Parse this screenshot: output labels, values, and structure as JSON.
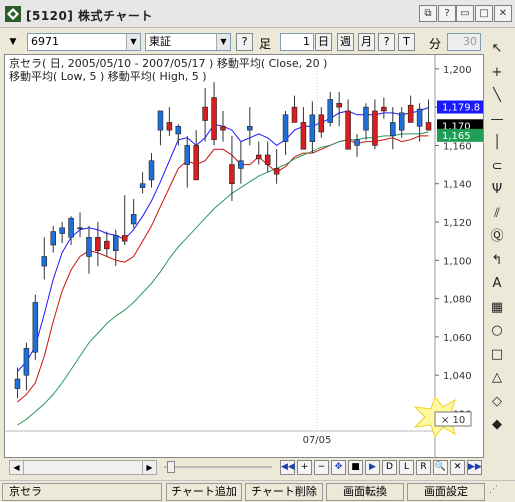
{
  "window": {
    "title": "[5120] 株式チャート",
    "buttons": [
      "restore-down",
      "help",
      "minimize",
      "maximize",
      "close"
    ]
  },
  "toolbar": {
    "symbol": "6971",
    "market": "東証",
    "help_label": "?",
    "foot_label": "足",
    "foot_count": "1",
    "day_label": "日",
    "week_label": "週",
    "month_label": "月",
    "split_label": "分",
    "q_label": "?",
    "t_label": "T",
    "min_label": "分",
    "min_count": "30"
  },
  "chart_data": {
    "type": "candlestick",
    "header_line1": "京セラ( 日, 2005/05/10 - 2007/05/17 )   移動平均( Close, 20 )",
    "header_line2": "移動平均( Low, 5 )   移動平均( High, 5 )",
    "y_ticks": [
      "1,200",
      "1,180",
      "1,160",
      "1,140",
      "1,120",
      "1,100",
      "1,080",
      "1,060",
      "1,040",
      "1,020"
    ],
    "ylim": [
      1014,
      1202
    ],
    "x_tick_label": "07/05",
    "badges": [
      {
        "label": "1,179.8",
        "value": 1179.8,
        "color": "#1a1aff"
      },
      {
        "label": "1,170",
        "value": 1170,
        "color": "#000000"
      },
      {
        "label": "1,165",
        "value": 1165,
        "color": "#1f9f55"
      }
    ],
    "candles": [
      {
        "o": 1033,
        "h": 1044,
        "l": 1028,
        "c": 1038
      },
      {
        "o": 1040,
        "h": 1057,
        "l": 1032,
        "c": 1054
      },
      {
        "o": 1052,
        "h": 1082,
        "l": 1048,
        "c": 1078
      },
      {
        "o": 1097,
        "h": 1112,
        "l": 1090,
        "c": 1102
      },
      {
        "o": 1108,
        "h": 1118,
        "l": 1104,
        "c": 1115
      },
      {
        "o": 1114,
        "h": 1120,
        "l": 1109,
        "c": 1117
      },
      {
        "o": 1112,
        "h": 1123,
        "l": 1108,
        "c": 1122
      },
      {
        "o": 1117,
        "h": 1125,
        "l": 1112,
        "c": 1117
      },
      {
        "o": 1102,
        "h": 1118,
        "l": 1093,
        "c": 1112
      },
      {
        "o": 1112,
        "h": 1120,
        "l": 1097,
        "c": 1105
      },
      {
        "o": 1110,
        "h": 1115,
        "l": 1102,
        "c": 1106
      },
      {
        "o": 1105,
        "h": 1116,
        "l": 1097,
        "c": 1113
      },
      {
        "o": 1113,
        "h": 1134,
        "l": 1108,
        "c": 1110
      },
      {
        "o": 1119,
        "h": 1132,
        "l": 1117,
        "c": 1124
      },
      {
        "o": 1138,
        "h": 1146,
        "l": 1135,
        "c": 1140
      },
      {
        "o": 1142,
        "h": 1156,
        "l": 1138,
        "c": 1152
      },
      {
        "o": 1168,
        "h": 1176,
        "l": 1160,
        "c": 1178
      },
      {
        "o": 1172,
        "h": 1180,
        "l": 1165,
        "c": 1168
      },
      {
        "o": 1166,
        "h": 1171,
        "l": 1160,
        "c": 1170
      },
      {
        "o": 1150,
        "h": 1165,
        "l": 1138,
        "c": 1160
      },
      {
        "o": 1160,
        "h": 1168,
        "l": 1152,
        "c": 1142
      },
      {
        "o": 1180,
        "h": 1190,
        "l": 1162,
        "c": 1173
      },
      {
        "o": 1185,
        "h": 1193,
        "l": 1160,
        "c": 1163
      },
      {
        "o": 1170,
        "h": 1178,
        "l": 1162,
        "c": 1168
      },
      {
        "o": 1150,
        "h": 1165,
        "l": 1131,
        "c": 1140
      },
      {
        "o": 1148,
        "h": 1162,
        "l": 1140,
        "c": 1152
      },
      {
        "o": 1168,
        "h": 1180,
        "l": 1160,
        "c": 1170
      },
      {
        "o": 1155,
        "h": 1162,
        "l": 1150,
        "c": 1153
      },
      {
        "o": 1155,
        "h": 1162,
        "l": 1146,
        "c": 1150
      },
      {
        "o": 1148,
        "h": 1158,
        "l": 1140,
        "c": 1145
      },
      {
        "o": 1162,
        "h": 1178,
        "l": 1155,
        "c": 1176
      },
      {
        "o": 1180,
        "h": 1186,
        "l": 1174,
        "c": 1172
      },
      {
        "o": 1172,
        "h": 1180,
        "l": 1160,
        "c": 1158
      },
      {
        "o": 1162,
        "h": 1183,
        "l": 1156,
        "c": 1176
      },
      {
        "o": 1176,
        "h": 1180,
        "l": 1164,
        "c": 1167
      },
      {
        "o": 1172,
        "h": 1188,
        "l": 1170,
        "c": 1184
      },
      {
        "o": 1182,
        "h": 1188,
        "l": 1170,
        "c": 1180
      },
      {
        "o": 1178,
        "h": 1184,
        "l": 1160,
        "c": 1158
      },
      {
        "o": 1160,
        "h": 1166,
        "l": 1154,
        "c": 1163
      },
      {
        "o": 1168,
        "h": 1182,
        "l": 1163,
        "c": 1180
      },
      {
        "o": 1178,
        "h": 1184,
        "l": 1158,
        "c": 1160
      },
      {
        "o": 1180,
        "h": 1185,
        "l": 1174,
        "c": 1178
      },
      {
        "o": 1165,
        "h": 1180,
        "l": 1158,
        "c": 1172
      },
      {
        "o": 1168,
        "h": 1180,
        "l": 1164,
        "c": 1177
      },
      {
        "o": 1181,
        "h": 1186,
        "l": 1172,
        "c": 1172
      },
      {
        "o": 1170,
        "h": 1182,
        "l": 1162,
        "c": 1179
      },
      {
        "o": 1172,
        "h": 1184,
        "l": 1168,
        "c": 1168
      }
    ],
    "series": [
      {
        "values": [
          1042,
          1047,
          1055,
          1072,
          1090,
          1104,
          1112,
          1116,
          1117,
          1116,
          1114,
          1113,
          1111,
          1116,
          1123,
          1131,
          1141,
          1152,
          1163,
          1164,
          1160,
          1164,
          1171,
          1170,
          1168,
          1162,
          1164,
          1166,
          1164,
          1160,
          1163,
          1168,
          1170,
          1170,
          1172,
          1174,
          1177,
          1178,
          1176,
          1176,
          1176,
          1177,
          1177,
          1176,
          1177,
          1178,
          1179.8
        ],
        "color": "#1a1aff"
      },
      {
        "values": [
          1026,
          1030,
          1036,
          1050,
          1068,
          1084,
          1095,
          1102,
          1105,
          1104,
          1102,
          1100,
          1099,
          1102,
          1110,
          1118,
          1128,
          1138,
          1148,
          1152,
          1150,
          1152,
          1158,
          1158,
          1155,
          1150,
          1150,
          1154,
          1150,
          1146,
          1149,
          1154,
          1156,
          1156,
          1158,
          1160,
          1162,
          1163,
          1161,
          1162,
          1162,
          1163,
          1164,
          1162,
          1163,
          1165,
          1165
        ],
        "color": "#cc1111"
      },
      {
        "values": [
          1014,
          1017,
          1021,
          1025,
          1030,
          1036,
          1043,
          1050,
          1057,
          1062,
          1067,
          1071,
          1074,
          1078,
          1083,
          1088,
          1094,
          1101,
          1107,
          1112,
          1117,
          1122,
          1127,
          1131,
          1135,
          1138,
          1141,
          1144,
          1146,
          1148,
          1150,
          1153,
          1155,
          1157,
          1159,
          1160,
          1162,
          1163,
          1163,
          1164,
          1164,
          1165,
          1165,
          1166,
          1166,
          1166,
          1167
        ],
        "color": "#2a9a5a"
      }
    ],
    "zoom_label": "× 10"
  },
  "palette": [
    {
      "name": "pointer-icon",
      "glyph": "↖"
    },
    {
      "name": "crosshair-icon",
      "glyph": "+"
    },
    {
      "name": "trendline-icon",
      "glyph": "╲"
    },
    {
      "name": "horizontal-line-icon",
      "glyph": "—"
    },
    {
      "name": "vertical-line-icon",
      "glyph": "│"
    },
    {
      "name": "parallel-line-icon",
      "glyph": "⊂"
    },
    {
      "name": "fibonacci-icon",
      "glyph": "Ψ"
    },
    {
      "name": "gann-fan-icon",
      "glyph": "⫽"
    },
    {
      "name": "price-label-icon",
      "glyph": "Ⓠ"
    },
    {
      "name": "arrow-turn-icon",
      "glyph": "↰"
    },
    {
      "name": "text-icon",
      "glyph": "A"
    },
    {
      "name": "table-icon",
      "glyph": "▦"
    },
    {
      "name": "ellipse-icon",
      "glyph": "○"
    },
    {
      "name": "rectangle-icon",
      "glyph": "□"
    },
    {
      "name": "triangle-icon",
      "glyph": "△"
    },
    {
      "name": "eraser-icon",
      "glyph": "◇"
    },
    {
      "name": "eraser-all-icon",
      "glyph": "◆"
    }
  ],
  "navigation": {
    "labels": [
      "◀◀",
      "+",
      "−",
      "✥",
      "■",
      "▶",
      "D",
      "L",
      "R",
      "🔍",
      "✕",
      "▶▶"
    ]
  },
  "status": {
    "name": "京セラ",
    "add_chart": "チャート追加",
    "delete_chart": "チャート削除",
    "screen_switch": "画面転換",
    "screen_settings": "画面設定"
  }
}
